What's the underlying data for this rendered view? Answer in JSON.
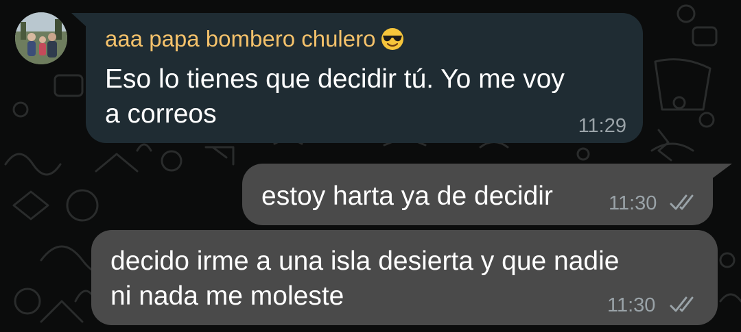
{
  "colors": {
    "background": "#0b0c0c",
    "incoming_bubble": "#1f2c33",
    "outgoing_bubble": "#4a4a4a",
    "sender_name": "#f5c26b",
    "timestamp": "#9aa3a8",
    "read_ticks": "#9aa3a8"
  },
  "messages": [
    {
      "direction": "incoming",
      "sender": "aaa papa bombero chulero",
      "sender_emoji_icon": "smiling-face-with-sunglasses-icon",
      "text_lines": [
        "Eso lo tienes que decidir tú. Yo me voy",
        "a correos"
      ],
      "time": "11:29"
    },
    {
      "direction": "outgoing",
      "text_lines": [
        "estoy harta ya de decidir"
      ],
      "time": "11:30",
      "status_icon": "double-check-icon"
    },
    {
      "direction": "outgoing",
      "text_lines": [
        "decido irme a una isla desierta y que nadie",
        "ni nada me moleste"
      ],
      "time": "11:30",
      "status_icon": "double-check-icon"
    }
  ]
}
